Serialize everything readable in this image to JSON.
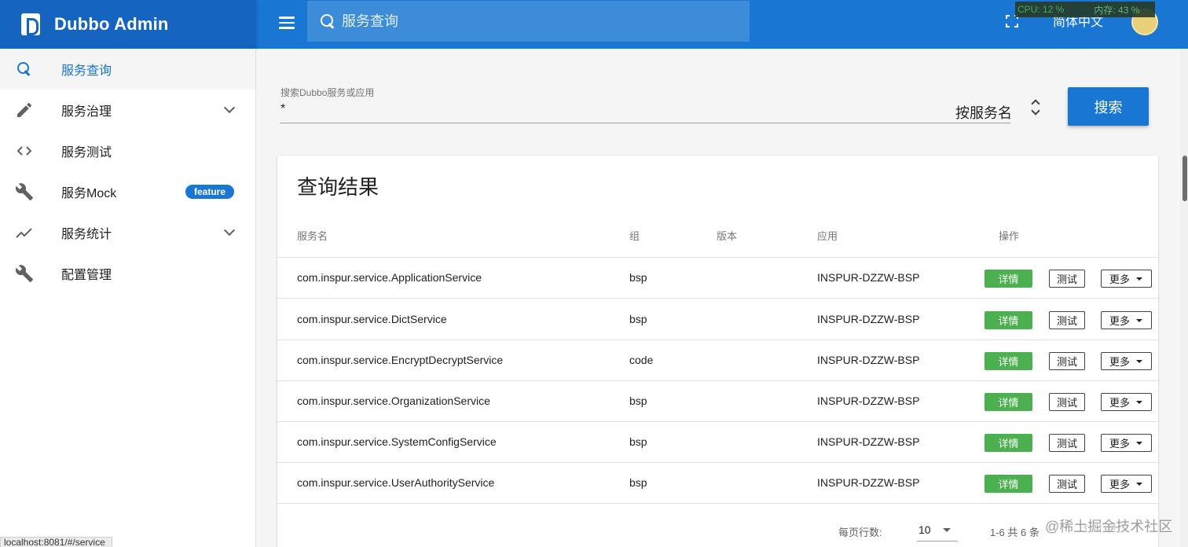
{
  "header": {
    "brand_title": "Dubbo Admin",
    "search_placeholder": "服务查询",
    "language": "简体中文",
    "cpu_text": "CPU: 12 %",
    "mem_text": "内存: 43 %"
  },
  "sidebar": {
    "items": [
      {
        "label": "服务查询",
        "icon": "search-icon",
        "active": true
      },
      {
        "label": "服务治理",
        "icon": "pencil-icon",
        "expandable": true
      },
      {
        "label": "服务测试",
        "icon": "code-icon"
      },
      {
        "label": "服务Mock",
        "icon": "wrench-icon",
        "badge": "feature"
      },
      {
        "label": "服务统计",
        "icon": "trending-icon",
        "expandable": true
      },
      {
        "label": "配置管理",
        "icon": "wrench-icon"
      }
    ]
  },
  "search_form": {
    "label": "搜索Dubbo服务或应用",
    "value": "*",
    "type_select": "按服务名",
    "button": "搜索"
  },
  "results": {
    "title": "查询结果",
    "columns": [
      "服务名",
      "组",
      "版本",
      "应用",
      "操作"
    ],
    "rows": [
      {
        "service": "com.inspur.service.ApplicationService",
        "group": "bsp",
        "version": "",
        "app": "INSPUR-DZZW-BSP"
      },
      {
        "service": "com.inspur.service.DictService",
        "group": "bsp",
        "version": "",
        "app": "INSPUR-DZZW-BSP"
      },
      {
        "service": "com.inspur.service.EncryptDecryptService",
        "group": "code",
        "version": "",
        "app": "INSPUR-DZZW-BSP"
      },
      {
        "service": "com.inspur.service.OrganizationService",
        "group": "bsp",
        "version": "",
        "app": "INSPUR-DZZW-BSP"
      },
      {
        "service": "com.inspur.service.SystemConfigService",
        "group": "bsp",
        "version": "",
        "app": "INSPUR-DZZW-BSP"
      },
      {
        "service": "com.inspur.service.UserAuthorityService",
        "group": "bsp",
        "version": "",
        "app": "INSPUR-DZZW-BSP"
      }
    ],
    "actions": {
      "detail": "详情",
      "test": "测试",
      "more": "更多"
    },
    "pagination": {
      "rows_per_page_label": "每页行数:",
      "rows_per_page": "10",
      "range_text": "1-6 共 6 条"
    }
  },
  "watermark": "@稀土掘金技术社区",
  "status_url": "localhost:8081/#/service",
  "colors": {
    "primary": "#1976d2",
    "brand_bg": "#1565c0",
    "success": "#4caf50"
  }
}
